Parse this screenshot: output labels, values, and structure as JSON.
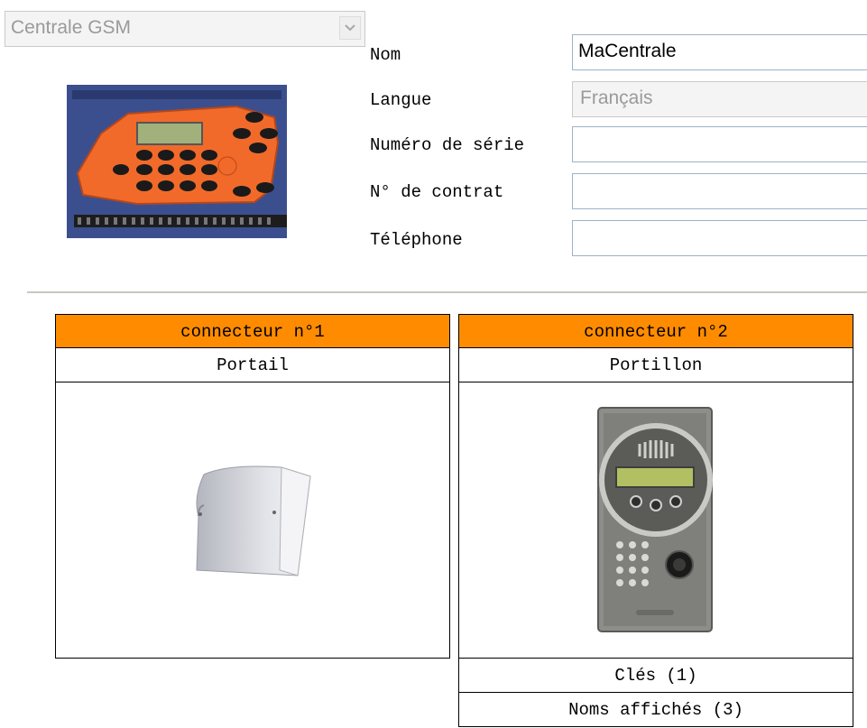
{
  "device": {
    "type_select": {
      "value": "Centrale GSM"
    },
    "photo_icon": "gsm-control-unit-photo"
  },
  "form": {
    "nom": {
      "label": "Nom",
      "value": "MaCentrale"
    },
    "langue": {
      "label": "Langue",
      "value": "Français"
    },
    "serie": {
      "label": "Numéro de série",
      "value": ""
    },
    "contrat": {
      "label": "N° de contrat",
      "value": ""
    },
    "telephone": {
      "label": "Téléphone",
      "value": ""
    }
  },
  "connectors": [
    {
      "header": "connecteur n°1",
      "name": "Portail",
      "image_icon": "receiver-box-icon"
    },
    {
      "header": "connecteur n°2",
      "name": "Portillon",
      "image_icon": "intercom-panel-icon",
      "links": [
        "Clés (1)",
        "Noms affichés (3)"
      ]
    }
  ],
  "colors": {
    "header_orange": "#ff8c00",
    "field_border": "#9db3c7"
  }
}
